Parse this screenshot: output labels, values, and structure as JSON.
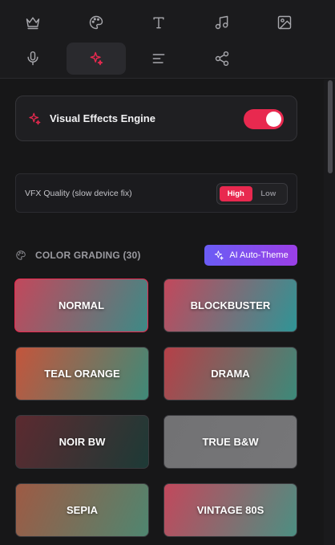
{
  "toolbar": {
    "tools": [
      {
        "name": "crown-icon",
        "active": false
      },
      {
        "name": "palette-icon",
        "active": false
      },
      {
        "name": "text-icon",
        "active": false
      },
      {
        "name": "music-icon",
        "active": false
      },
      {
        "name": "image-icon",
        "active": false
      },
      {
        "name": "microphone-icon",
        "active": false
      },
      {
        "name": "sparkles-icon",
        "active": true
      },
      {
        "name": "align-left-icon",
        "active": false
      },
      {
        "name": "share-icon",
        "active": false
      }
    ]
  },
  "engine": {
    "label": "Visual Effects Engine",
    "enabled": true,
    "icon": "sparkles-icon"
  },
  "quality": {
    "label": "VFX Quality (slow device fix)",
    "options": [
      "High",
      "Low"
    ],
    "selected": "High"
  },
  "color_grading": {
    "title": "COLOR GRADING (30)",
    "ai_button": "AI Auto-Theme",
    "presets": [
      {
        "label": "NORMAL",
        "selected": true,
        "colors": [
          "#c2485c",
          "#3d8a86"
        ]
      },
      {
        "label": "BLOCKBUSTER",
        "selected": false,
        "colors": [
          "#c2485c",
          "#2f9596"
        ]
      },
      {
        "label": "TEAL ORANGE",
        "selected": false,
        "colors": [
          "#c4553c",
          "#3f8a78"
        ]
      },
      {
        "label": "DRAMA",
        "selected": false,
        "colors": [
          "#b64048",
          "#3c8a7a"
        ]
      },
      {
        "label": "NOIR BW",
        "selected": false,
        "colors": [
          "#5c2a30",
          "#1d3a36"
        ]
      },
      {
        "label": "TRUE B&W",
        "selected": false,
        "colors": [
          "#727274",
          "#767678"
        ]
      },
      {
        "label": "SEPIA",
        "selected": false,
        "colors": [
          "#9e5a44",
          "#4f8670"
        ]
      },
      {
        "label": "VINTAGE 80S",
        "selected": false,
        "colors": [
          "#c2485c",
          "#4c8f82"
        ]
      }
    ]
  },
  "colors": {
    "accent": "#e8294f",
    "background": "#171718",
    "ai_gradient": [
      "#6a5cf5",
      "#9b3fe6"
    ]
  }
}
